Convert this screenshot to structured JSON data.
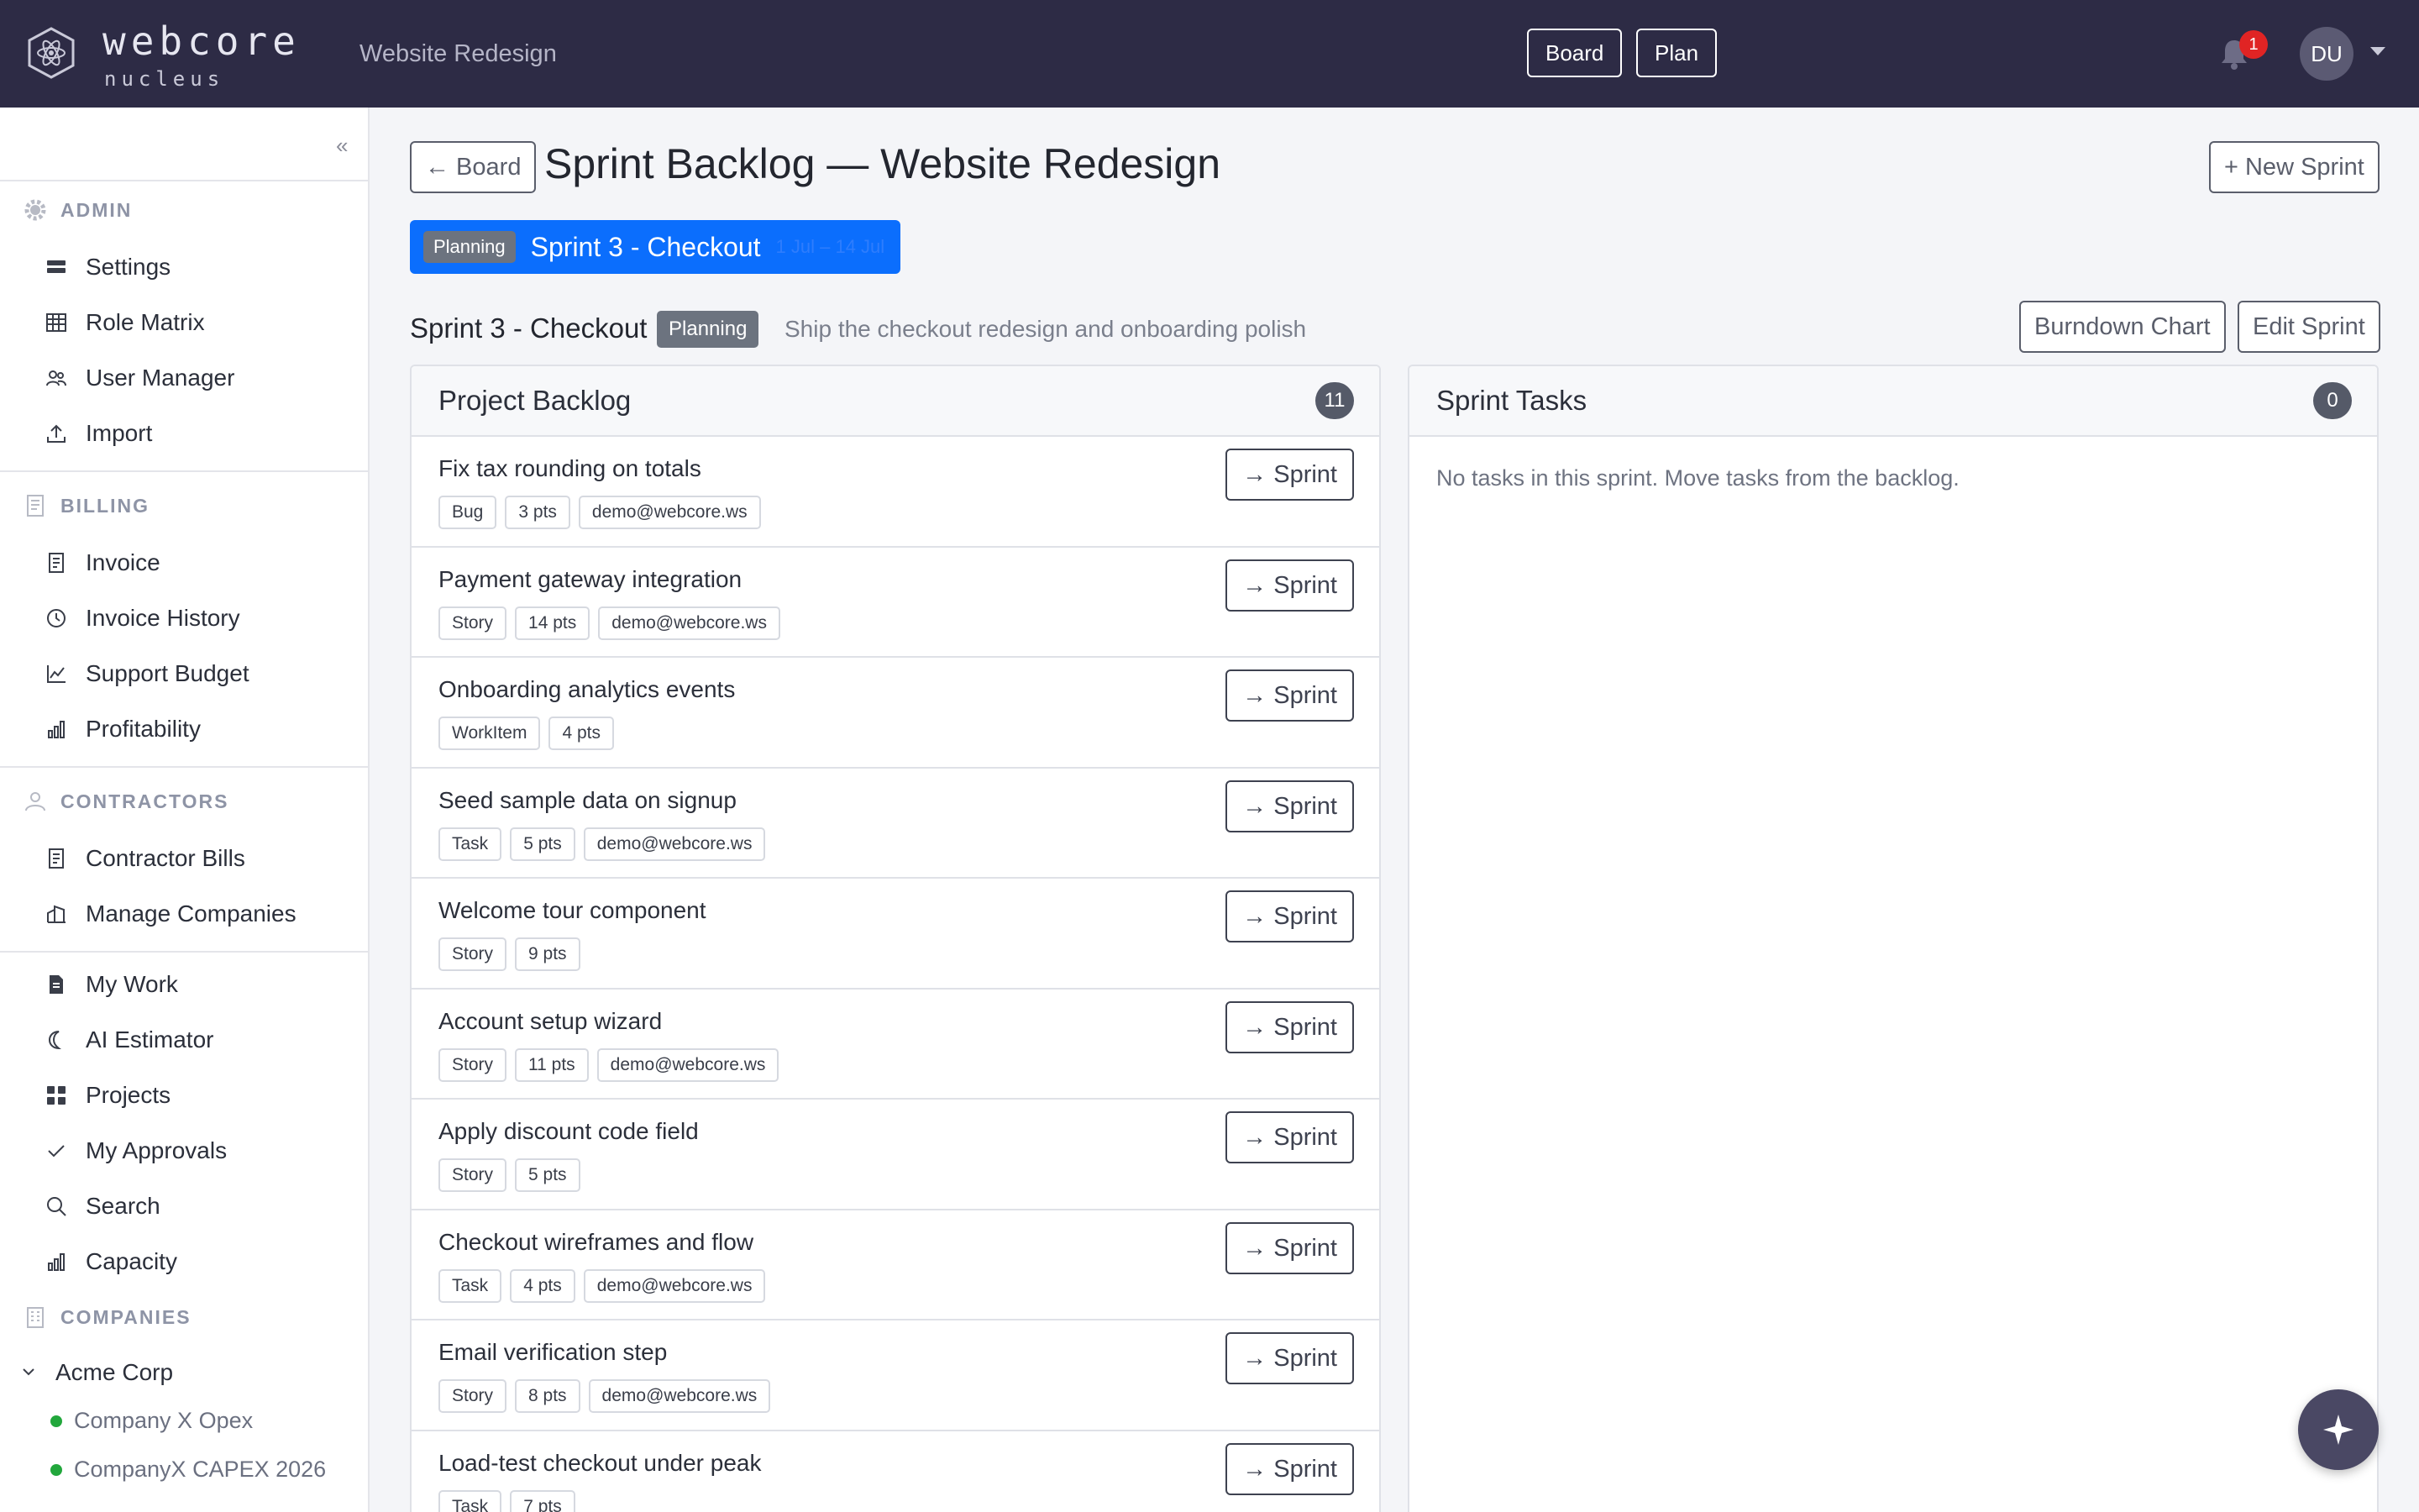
{
  "brand": {
    "name": "webcore",
    "sub": "nucleus"
  },
  "header": {
    "project": "Website Redesign",
    "board_label": "Board",
    "plan_label": "Plan",
    "notif_count": "1",
    "user_initials": "DU"
  },
  "sidebar": {
    "collapse_glyph": "«",
    "admin": {
      "title": "ADMIN",
      "items": [
        "Settings",
        "Role Matrix",
        "User Manager",
        "Import"
      ]
    },
    "billing": {
      "title": "BILLING",
      "items": [
        "Invoice",
        "Invoice History",
        "Support Budget",
        "Profitability"
      ]
    },
    "contractors": {
      "title": "CONTRACTORS",
      "items": [
        "Contractor Bills",
        "Manage Companies"
      ]
    },
    "general": {
      "items": [
        "My Work",
        "AI Estimator",
        "Projects",
        "My Approvals",
        "Search",
        "Capacity"
      ]
    },
    "companies": {
      "title": "COMPANIES",
      "group": "Acme Corp",
      "items": [
        "Company X Opex",
        "CompanyX CAPEX 2026"
      ]
    }
  },
  "main": {
    "back_label": "← Board",
    "title": "Sprint Backlog — Website Redesign",
    "new_sprint_label": "+ New Sprint",
    "sprint_tab": {
      "status": "Planning",
      "name": "Sprint 3 - Checkout",
      "dates": "1 Jul – 14 Jul"
    },
    "sprint": {
      "name": "Sprint 3 - Checkout",
      "status": "Planning",
      "goal": "Ship the checkout redesign and onboarding polish",
      "burndown_label": "Burndown Chart",
      "edit_label": "Edit Sprint"
    },
    "backlog": {
      "title": "Project Backlog",
      "count": "11",
      "move_label": "→ Sprint",
      "tasks": [
        {
          "title": "Fix tax rounding on totals",
          "type": "Bug",
          "pts": "3 pts",
          "assignee": "demo@webcore.ws"
        },
        {
          "title": "Payment gateway integration",
          "type": "Story",
          "pts": "14 pts",
          "assignee": "demo@webcore.ws"
        },
        {
          "title": "Onboarding analytics events",
          "type": "WorkItem",
          "pts": "4 pts",
          "assignee": ""
        },
        {
          "title": "Seed sample data on signup",
          "type": "Task",
          "pts": "5 pts",
          "assignee": "demo@webcore.ws"
        },
        {
          "title": "Welcome tour component",
          "type": "Story",
          "pts": "9 pts",
          "assignee": ""
        },
        {
          "title": "Account setup wizard",
          "type": "Story",
          "pts": "11 pts",
          "assignee": "demo@webcore.ws"
        },
        {
          "title": "Apply discount code field",
          "type": "Story",
          "pts": "5 pts",
          "assignee": ""
        },
        {
          "title": "Checkout wireframes and flow",
          "type": "Task",
          "pts": "4 pts",
          "assignee": "demo@webcore.ws"
        },
        {
          "title": "Email verification step",
          "type": "Story",
          "pts": "8 pts",
          "assignee": "demo@webcore.ws"
        },
        {
          "title": "Load-test checkout under peak",
          "type": "Task",
          "pts": "7 pts",
          "assignee": ""
        }
      ]
    },
    "sprint_tasks": {
      "title": "Sprint Tasks",
      "count": "0",
      "empty": "No tasks in this sprint. Move tasks from the backlog."
    }
  },
  "colors": {
    "topbar": "#2d2b45",
    "accent": "#0b6efd",
    "badge": "#6c737f",
    "dot": "#22a73c"
  }
}
